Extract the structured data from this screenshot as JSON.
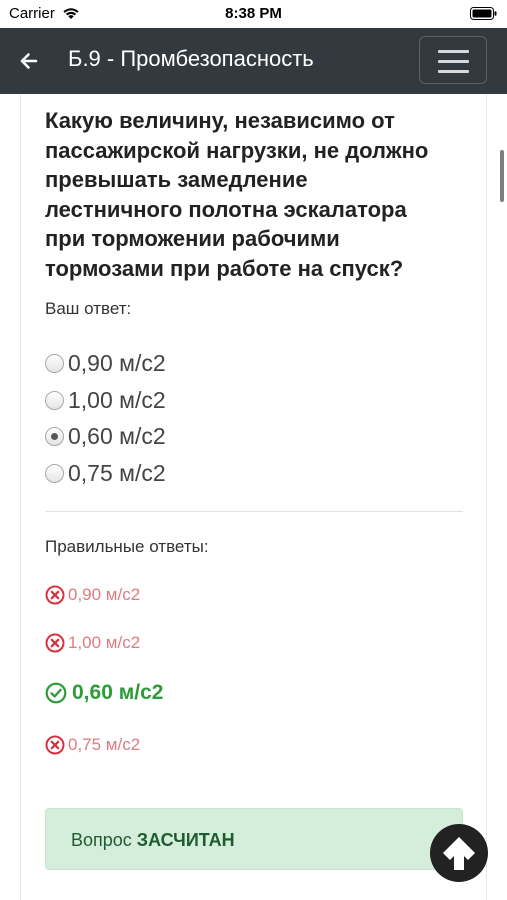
{
  "status_bar": {
    "carrier": "Carrier",
    "time": "8:38 PM"
  },
  "navbar": {
    "title": "Б.9 - Промбезопасность"
  },
  "question": {
    "lines": [
      "Какую величину, независимо от",
      "пассажирской нагрузки, не должно",
      "превышать замедление",
      "лестничного полотна эскалатора",
      "при торможении рабочими",
      "тормозами при работе на спуск?"
    ],
    "your_answer_label": "Ваш ответ:",
    "options": [
      {
        "label": "0,90 м/с2",
        "selected": false
      },
      {
        "label": "1,00 м/с2",
        "selected": false
      },
      {
        "label": "0,60 м/с2",
        "selected": true
      },
      {
        "label": "0,75 м/с2",
        "selected": false
      }
    ]
  },
  "correct_answers": {
    "heading": "Правильные ответы:",
    "items": [
      {
        "label": "0,90 м/с2",
        "correct": false
      },
      {
        "label": "1,00 м/с2",
        "correct": false
      },
      {
        "label": "0,60 м/с2",
        "correct": true
      },
      {
        "label": "0,75 м/с2",
        "correct": false
      }
    ]
  },
  "result_alert": {
    "prefix": "Вопрос ",
    "verdict": "ЗАСЧИТАН"
  },
  "colors": {
    "navbar": "#333a3f",
    "correct": "#2e9b38",
    "wrong": "#d9323f",
    "alert_bg": "#d5eddb"
  },
  "icons": [
    "wifi-icon",
    "battery-icon",
    "back-arrow-icon",
    "hamburger-menu-icon",
    "wrong-circle-icon",
    "check-circle-icon",
    "scroll-up-arrow-icon"
  ]
}
